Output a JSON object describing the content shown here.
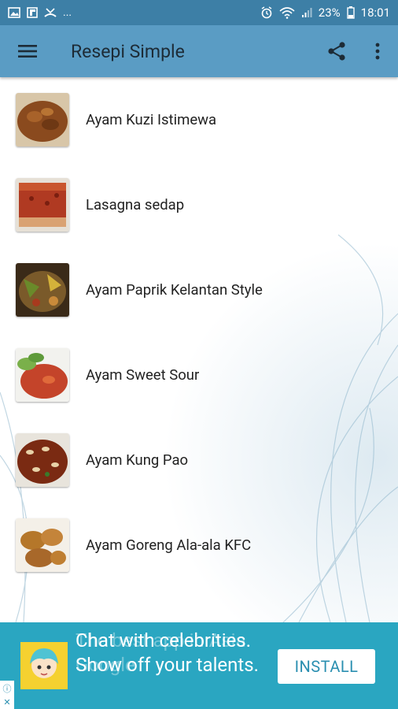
{
  "status_bar": {
    "battery": "23%",
    "time": "18:01",
    "left_icons": [
      "gallery-icon",
      "flipboard-icon",
      "missed-call-icon",
      "more-notifications"
    ],
    "more_text": "..."
  },
  "toolbar": {
    "title": "Resepi Simple",
    "color": "#5a9cc4"
  },
  "recipes": [
    {
      "label": "Ayam Kuzi Istimewa",
      "thumb_color": "#8a4a1e"
    },
    {
      "label": "Lasagna sedap",
      "thumb_color": "#b03a22"
    },
    {
      "label": "Ayam Paprik Kelantan Style",
      "thumb_color": "#7a5a2a"
    },
    {
      "label": "Ayam Sweet Sour",
      "thumb_color": "#c4442a"
    },
    {
      "label": "Ayam Kung Pao",
      "thumb_color": "#7a2a12"
    },
    {
      "label": "Ayam Goreng Ala-ala KFC",
      "thumb_color": "#b5772a"
    }
  ],
  "ad": {
    "text": "Chat with celebrities. Show off your talents.",
    "ghost_text": "The best app in Asia. Google",
    "install_label": "INSTALL",
    "color": "#2aa6c1"
  }
}
